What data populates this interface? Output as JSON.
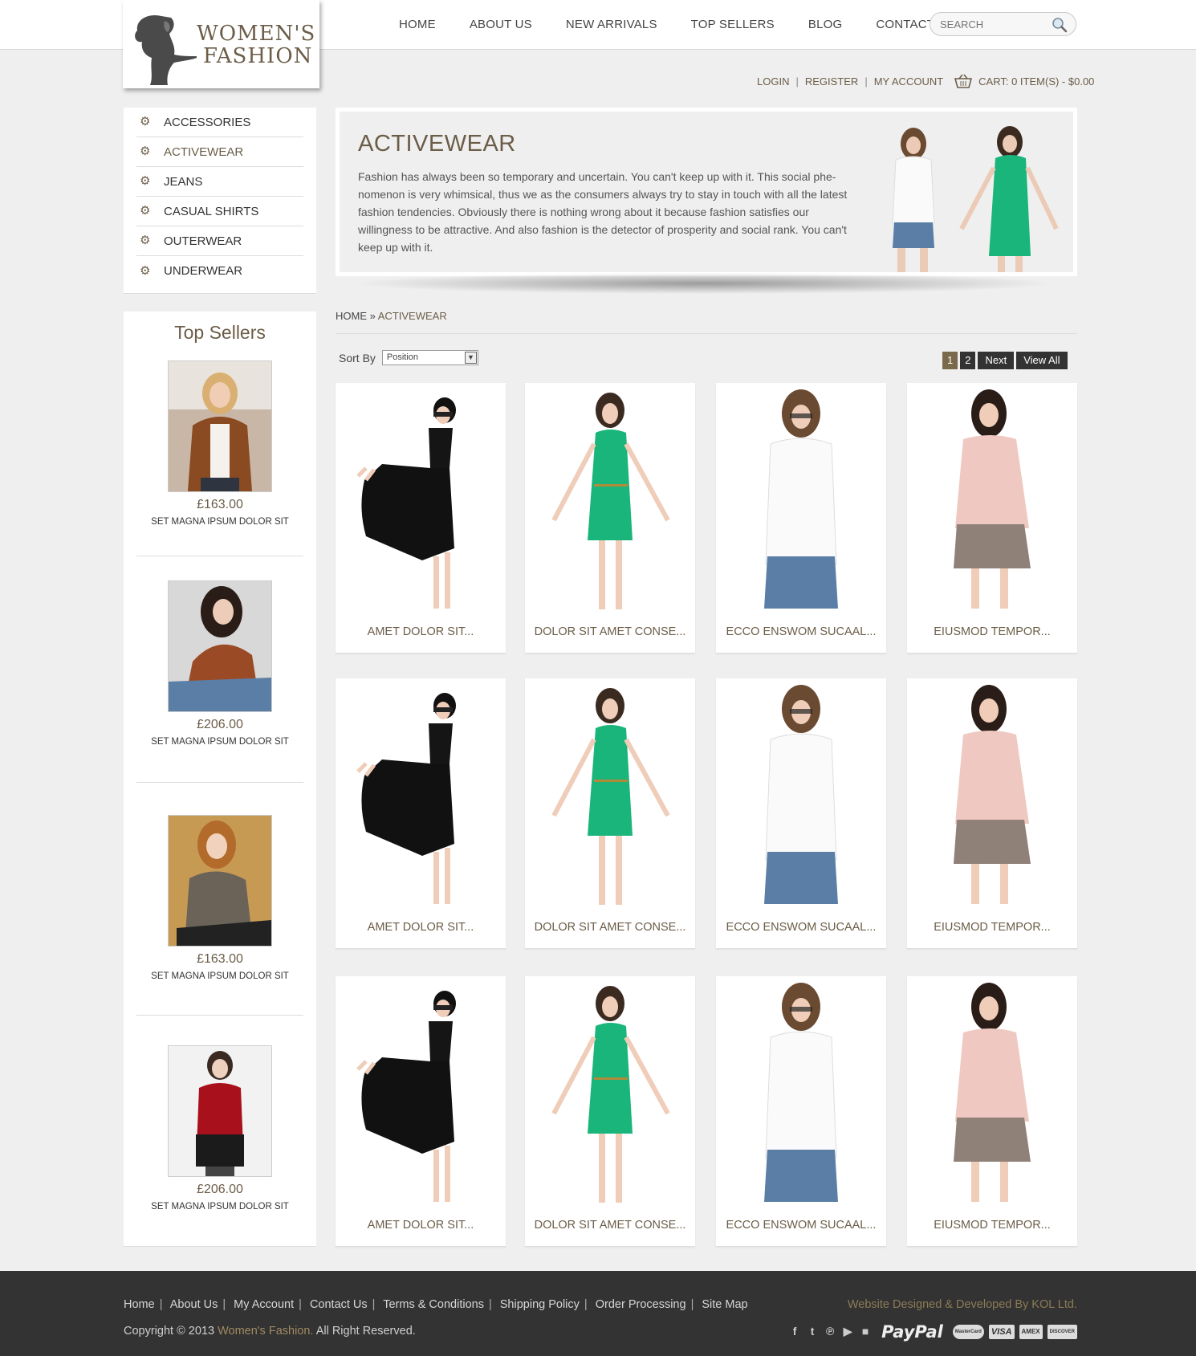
{
  "header": {
    "logo_text_1": "WOMEN'S",
    "logo_text_2": "FASHION",
    "nav": [
      "HOME",
      "ABOUT US",
      "NEW ARRIVALS",
      "TOP SELLERS",
      "BLOG",
      "CONTACT US"
    ],
    "search_placeholder": "SEARCH",
    "account": {
      "login": "LOGIN",
      "register": "REGISTER",
      "my_account": "MY ACCOUNT",
      "cart": "CART: 0 ITEM(S) - $0.00"
    }
  },
  "sidebar": {
    "categories": [
      {
        "label": "ACCESSORIES",
        "active": false
      },
      {
        "label": "ACTIVEWEAR",
        "active": true
      },
      {
        "label": "JEANS",
        "active": false
      },
      {
        "label": "CASUAL SHIRTS",
        "active": false
      },
      {
        "label": "OUTERWEAR",
        "active": false
      },
      {
        "label": "UNDERWEAR",
        "active": false
      }
    ],
    "top_sellers_title": "Top Sellers",
    "top_sellers": [
      {
        "price": "£163.00",
        "name": "SET MAGNA IPSUM DOLOR SIT"
      },
      {
        "price": "£206.00",
        "name": "SET MAGNA IPSUM DOLOR SIT"
      },
      {
        "price": "£163.00",
        "name": "SET MAGNA IPSUM DOLOR SIT"
      },
      {
        "price": "£206.00",
        "name": "SET MAGNA IPSUM DOLOR SIT"
      }
    ]
  },
  "banner": {
    "title": "ACTIVEWEAR",
    "text": "Fashion has always been so temporary and uncertain. You can't keep up with it. This social phe-nomenon is very whimsical, thus we as the consumers always try to stay in touch with all the latest fashion tendencies. Obviously there is nothing wrong about it because fashion satisfies our willingness to be attractive. And also fashion is the detector of prosperity and social rank. You can't keep up with it."
  },
  "breadcrumb": {
    "home": "HOME",
    "sep": "»",
    "current": "ACTIVEWEAR"
  },
  "toolbar": {
    "sort_label": "Sort By",
    "sort_value": "Position",
    "pages": [
      "1",
      "2"
    ],
    "next": "Next",
    "view_all": "View All"
  },
  "products": [
    {
      "name": "AMET DOLOR SIT...",
      "img": "polka"
    },
    {
      "name": "DOLOR SIT AMET CONSE...",
      "img": "green"
    },
    {
      "name": "ECCO ENSWOM SUCAAL...",
      "img": "white"
    },
    {
      "name": "EIUSMOD TEMPOR...",
      "img": "pink"
    },
    {
      "name": "AMET DOLOR SIT...",
      "img": "polka"
    },
    {
      "name": "DOLOR SIT AMET CONSE...",
      "img": "green"
    },
    {
      "name": "ECCO ENSWOM SUCAAL...",
      "img": "white"
    },
    {
      "name": "EIUSMOD TEMPOR...",
      "img": "pink"
    },
    {
      "name": "AMET DOLOR SIT...",
      "img": "polka"
    },
    {
      "name": "DOLOR SIT AMET CONSE...",
      "img": "green"
    },
    {
      "name": "ECCO ENSWOM SUCAAL...",
      "img": "white"
    },
    {
      "name": "EIUSMOD TEMPOR...",
      "img": "pink"
    }
  ],
  "footer": {
    "links": [
      "Home",
      "About Us",
      "My Account",
      "Contact Us",
      "Terms & Conditions",
      "Shipping Policy",
      "Order Processing",
      "Site Map"
    ],
    "copyright_prefix": "Copyright © 2013",
    "brand": "Women's Fashion.",
    "copyright_suffix": "All Right Reserved.",
    "credit": "Website Designed & Developed By KOL Ltd.",
    "paypal": "PayPal",
    "social_icons": [
      "facebook-icon",
      "twitter-icon",
      "pinterest-icon",
      "youtube-icon",
      "blogger-icon"
    ],
    "cards": [
      "MasterCard",
      "VISA",
      "AMEX",
      "DISCOVER"
    ]
  },
  "colors": {
    "accent": "#6b5d48",
    "footer_bg": "#333333",
    "page_bg": "#efefef"
  }
}
